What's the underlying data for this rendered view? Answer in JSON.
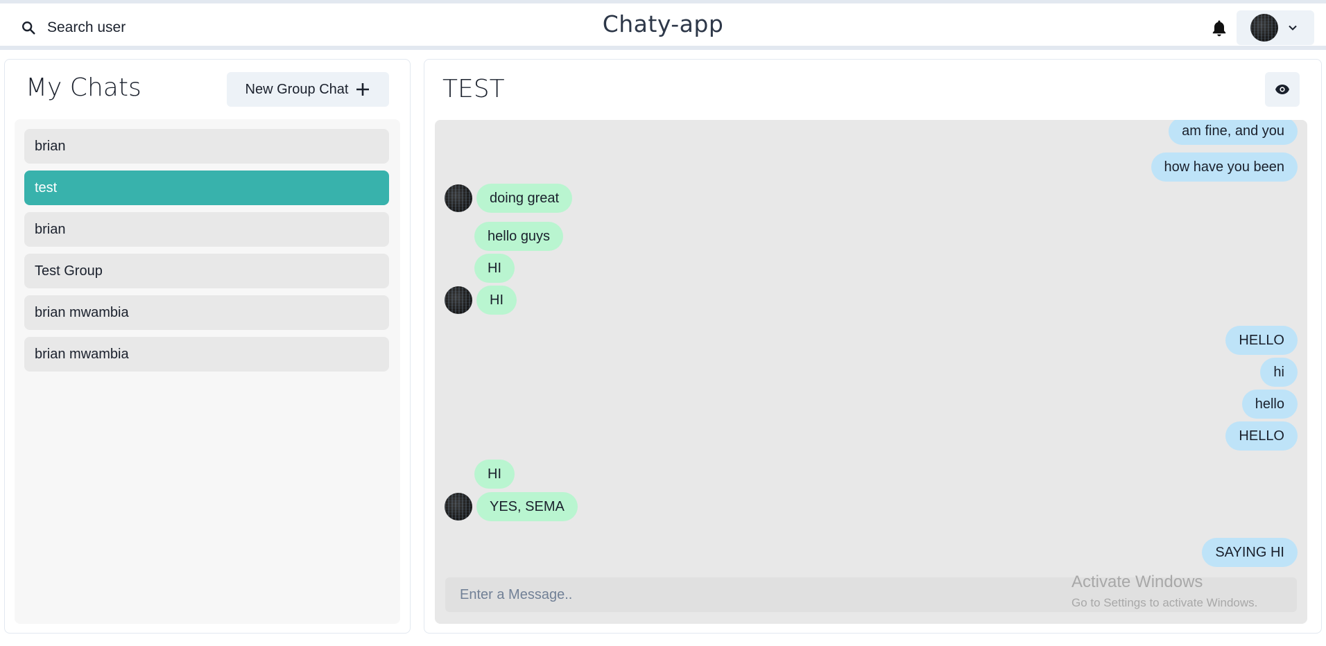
{
  "header": {
    "search_label": "Search user",
    "app_title": "Chaty-app",
    "search_icon": "search-icon",
    "bell_icon": "bell-icon",
    "chevron_icon": "chevron-down-icon"
  },
  "sidebar": {
    "title": "My Chats",
    "new_group_label": "New Group Chat",
    "chats": [
      {
        "name": "brian",
        "active": false
      },
      {
        "name": "test",
        "active": true
      },
      {
        "name": "brian",
        "active": false
      },
      {
        "name": "Test Group",
        "active": false
      },
      {
        "name": "brian mwambia",
        "active": false
      },
      {
        "name": "brian mwambia",
        "active": false
      }
    ]
  },
  "chat": {
    "name": "TEST",
    "view_icon": "eye-icon",
    "messages": [
      {
        "text": "am fine, and you",
        "direction": "sent"
      },
      {
        "text": "how have you been",
        "direction": "sent"
      },
      {
        "text": "doing great",
        "direction": "received",
        "avatar": true
      },
      {
        "text": "hello guys",
        "direction": "received",
        "avatar": false
      },
      {
        "text": "HI",
        "direction": "received",
        "avatar": false
      },
      {
        "text": "HI",
        "direction": "received",
        "avatar": true
      },
      {
        "text": "HELLO",
        "direction": "sent"
      },
      {
        "text": "hi",
        "direction": "sent"
      },
      {
        "text": "hello",
        "direction": "sent"
      },
      {
        "text": "HELLO",
        "direction": "sent"
      },
      {
        "text": "HI",
        "direction": "received",
        "avatar": false
      },
      {
        "text": "YES, SEMA",
        "direction": "received",
        "avatar": true
      },
      {
        "text": "SAYING HI",
        "direction": "sent"
      }
    ],
    "input_placeholder": "Enter a Message.."
  },
  "watermark": {
    "title": "Activate Windows",
    "subtitle": "Go to Settings to activate Windows."
  },
  "colors": {
    "accent": "#38b2ac",
    "sent_bubble": "#bee3f8",
    "received_bubble": "#b9f5d0"
  }
}
